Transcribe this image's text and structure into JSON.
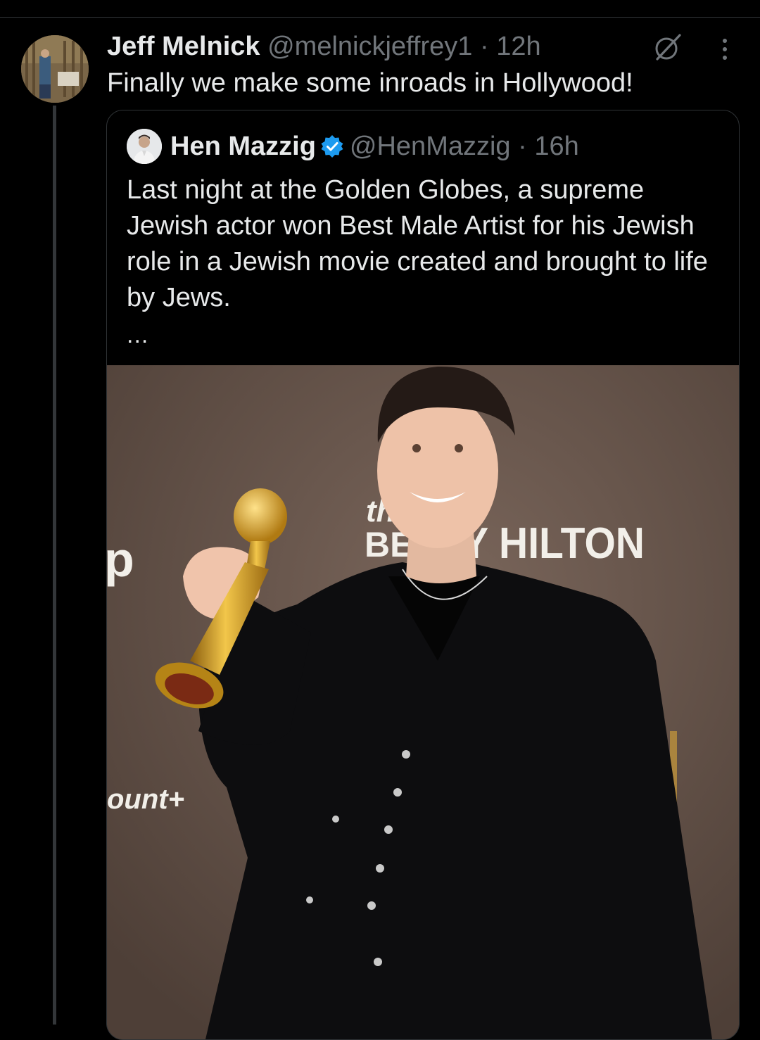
{
  "tweet": {
    "author_name": "Jeff Melnick",
    "handle": "@melnickjeffrey1",
    "separator": "·",
    "time": "12h",
    "text": "Finally we make some inroads in Hollywood!",
    "icons": {
      "grok": "grok-icon",
      "more": "more-options-icon"
    }
  },
  "quoted_tweet": {
    "author_name": "Hen Mazzig",
    "verified": true,
    "handle": "@HenMazzig",
    "separator": "·",
    "time": "16h",
    "text": "Last night at the Golden Globes, a supreme Jewish actor won Best Male Artist for his Jewish role in a Jewish movie created and brought to life by Jews.",
    "truncation": "...",
    "photo": {
      "backdrop_text_1": "the",
      "backdrop_text_2": "BE",
      "backdrop_text_3": "Y HILTON",
      "backdrop_text_4": "ount+"
    }
  },
  "colors": {
    "background": "#000000",
    "text": "#e7e9ea",
    "muted": "#71767b",
    "border": "#2f3336",
    "verified_blue": "#1d9bf0"
  }
}
